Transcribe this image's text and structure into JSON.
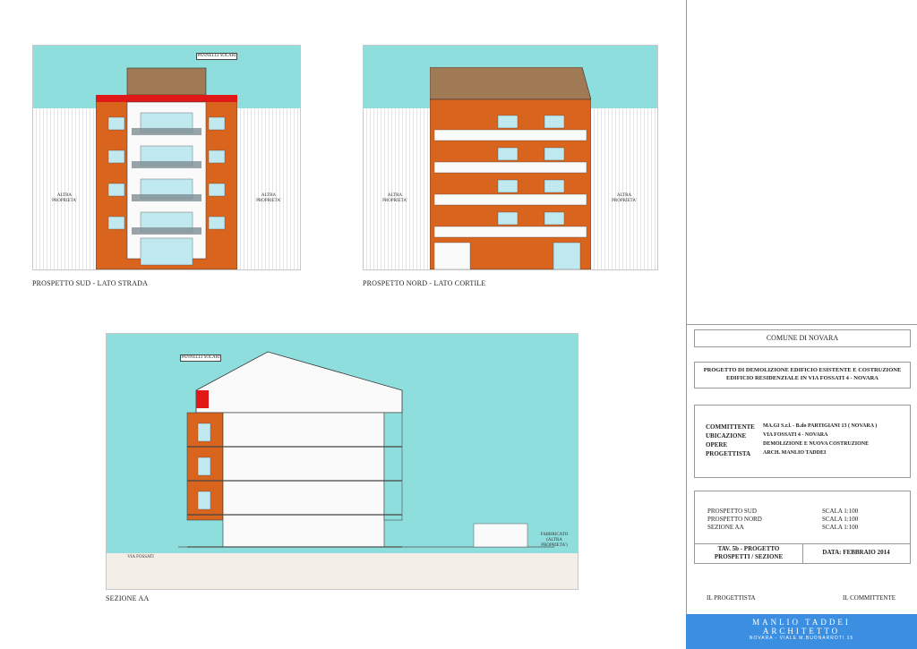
{
  "elevations": {
    "sud": {
      "caption": "PROSPETTO SUD - LATO STRADA",
      "left_label": "ALTRA PROPRIETA'",
      "right_label": "ALTRA PROPRIETA'",
      "roof_label": "PANNELLI SOLARI"
    },
    "nord": {
      "caption": "PROSPETTO NORD - LATO CORTILE",
      "left_label": "ALTRA PROPRIETA'",
      "right_label": "ALTRA PROPRIETA'"
    }
  },
  "section": {
    "caption": "SEZIONE AA",
    "roof_label": "PANNELLI SOLARI",
    "street_label": "VIA FOSSATI",
    "neighbor_label": "FABBRICATO (ALTRA PROPRIETA')"
  },
  "title_block": {
    "comune": "COMUNE DI NOVARA",
    "project_line1": "PROGETTO DI DEMOLIZIONE EDIFICIO ESISTENTE E COSTRUZIONE",
    "project_line2": "EDIFICIO RESIDENZIALE IN VIA FOSSATI 4 - NOVARA",
    "info": [
      {
        "label": "COMMITTENTE",
        "value": "MA.GI S.r.l. - B.do PARTIGIANI 13 ( NOVARA )"
      },
      {
        "label": "UBICAZIONE",
        "value": "VIA FOSSATI  4  - NOVARA"
      },
      {
        "label": "OPERE",
        "value": "DEMOLIZIONE E NUOVA COSTRUZIONE"
      },
      {
        "label": "PROGETTISTA",
        "value": "ARCH. MANLIO TADDEI"
      }
    ],
    "scales": [
      {
        "label": "PROSPETTO SUD",
        "value": "SCALA 1:100"
      },
      {
        "label": "PROSPETTO NORD",
        "value": "SCALA 1:100"
      },
      {
        "label": "SEZIONE AA",
        "value": "SCALA 1:100"
      }
    ],
    "tav_line1": "TAV. 5b - PROGETTO",
    "tav_line2": "PROSPETTI / SEZIONE",
    "date": "DATA: FEBBRAIO 2014",
    "progettista": "IL PROGETTISTA",
    "committente": "IL COMMITTENTE",
    "footer_line1": "MANLIO TADDEI",
    "footer_line2": "ARCHITETTO",
    "footer_line3": "NOVARA - VIALE M.BUONARROTI 15",
    "colors": {
      "sky": "#8fdede",
      "brick": "#d9641e",
      "roof": "#a07a55",
      "accent_red": "#e01818",
      "footer": "#3c8fe0"
    }
  }
}
